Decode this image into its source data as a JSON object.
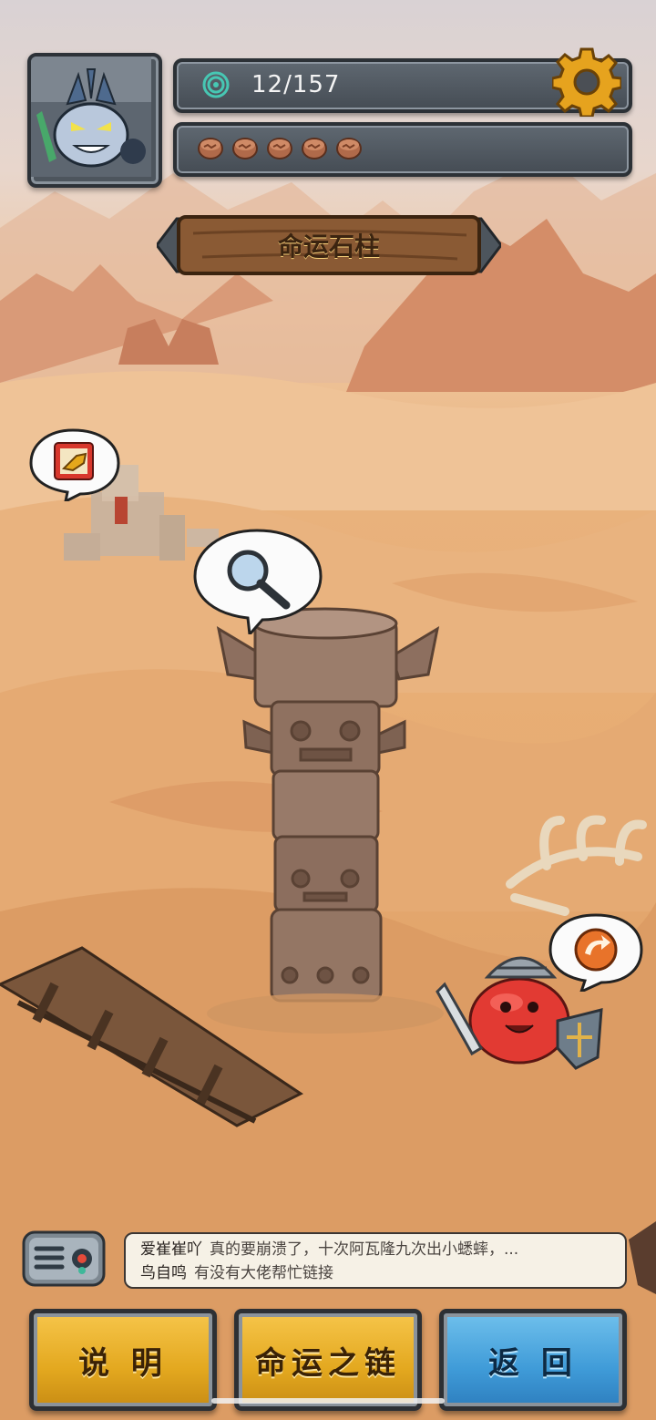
{
  "hud": {
    "progress_text": "12/157",
    "token_count": 5,
    "avatar_icon": "horned-monster-avatar",
    "settings_icon": "gear-icon"
  },
  "title": "命运石柱",
  "map_bubbles": [
    {
      "icon": "scroll-horn-icon"
    },
    {
      "icon": "magnifier-icon"
    },
    {
      "icon": "refresh-icon"
    }
  ],
  "chat": {
    "messages": [
      {
        "name": "爱崔崔吖",
        "text": "真的要崩溃了，十次阿瓦隆九次出小蟋蟀，..."
      },
      {
        "name": "鸟自鸣",
        "text": "有没有大佬帮忙链接"
      }
    ]
  },
  "buttons": {
    "help": "说 明",
    "chain": "命运之链",
    "back": "返 回"
  },
  "colors": {
    "yellow_button": "#e3a81f",
    "blue_button": "#3f9bd8",
    "sand": "#e7ac72"
  }
}
